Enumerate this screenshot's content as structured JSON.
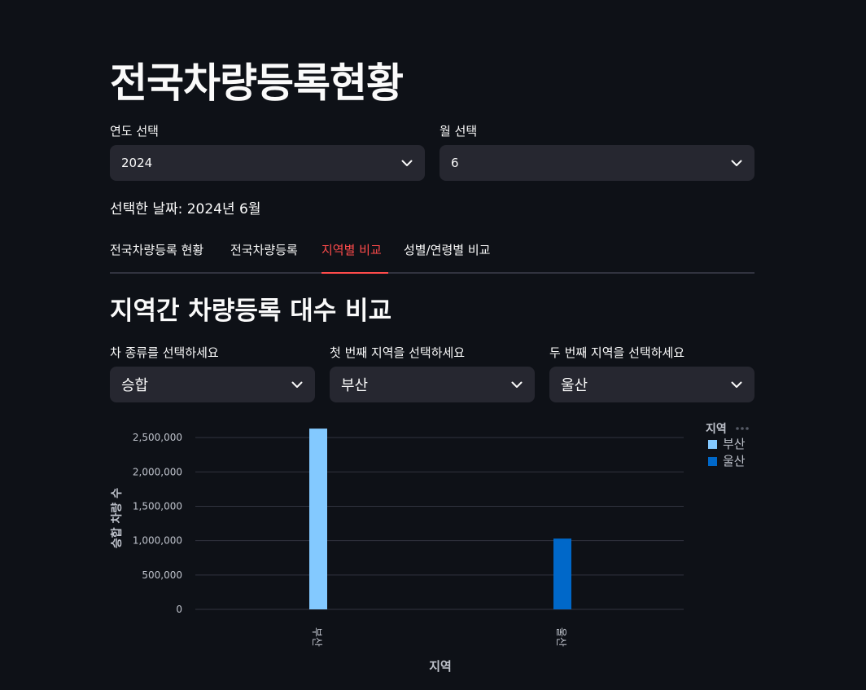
{
  "page": {
    "title": "전국차량등록현황",
    "year_label": "연도 선택",
    "year_value": "2024",
    "month_label": "월 선택",
    "month_value": "6",
    "selected_date": "선택한 날짜: 2024년 6월"
  },
  "tabs": [
    {
      "label": "전국차량등록 현황"
    },
    {
      "label": "전국차량등록"
    },
    {
      "label": "지역별 비교"
    },
    {
      "label": "성별/연령별 비교"
    }
  ],
  "section": {
    "title": "지역간 차량등록 대수 비교",
    "type_label": "차 종류를 선택하세요",
    "type_value": "승합",
    "region1_label": "첫 번째 지역을 선택하세요",
    "region1_value": "부산",
    "region2_label": "두 번째 지역을 선택하세요",
    "region2_value": "울산"
  },
  "icons": {
    "dropdown": "chevron-down-icon",
    "legend_menu": "more-horizontal-icon"
  },
  "chart_data": {
    "type": "bar",
    "categories": [
      "부산",
      "울산"
    ],
    "values": [
      2630000,
      1030000
    ],
    "colors": [
      "#83c9ff",
      "#0068c9"
    ],
    "xlabel": "지역",
    "ylabel": "승합 차량 수",
    "ylim": [
      0,
      2750000
    ],
    "yticks": [
      0,
      500000,
      1000000,
      1500000,
      2000000,
      2500000
    ],
    "ytick_labels": [
      "0",
      "500,000",
      "1,000,000",
      "1,500,000",
      "2,000,000",
      "2,500,000"
    ],
    "legend_title": "지역",
    "legend_position": "top-right",
    "grid": true
  }
}
